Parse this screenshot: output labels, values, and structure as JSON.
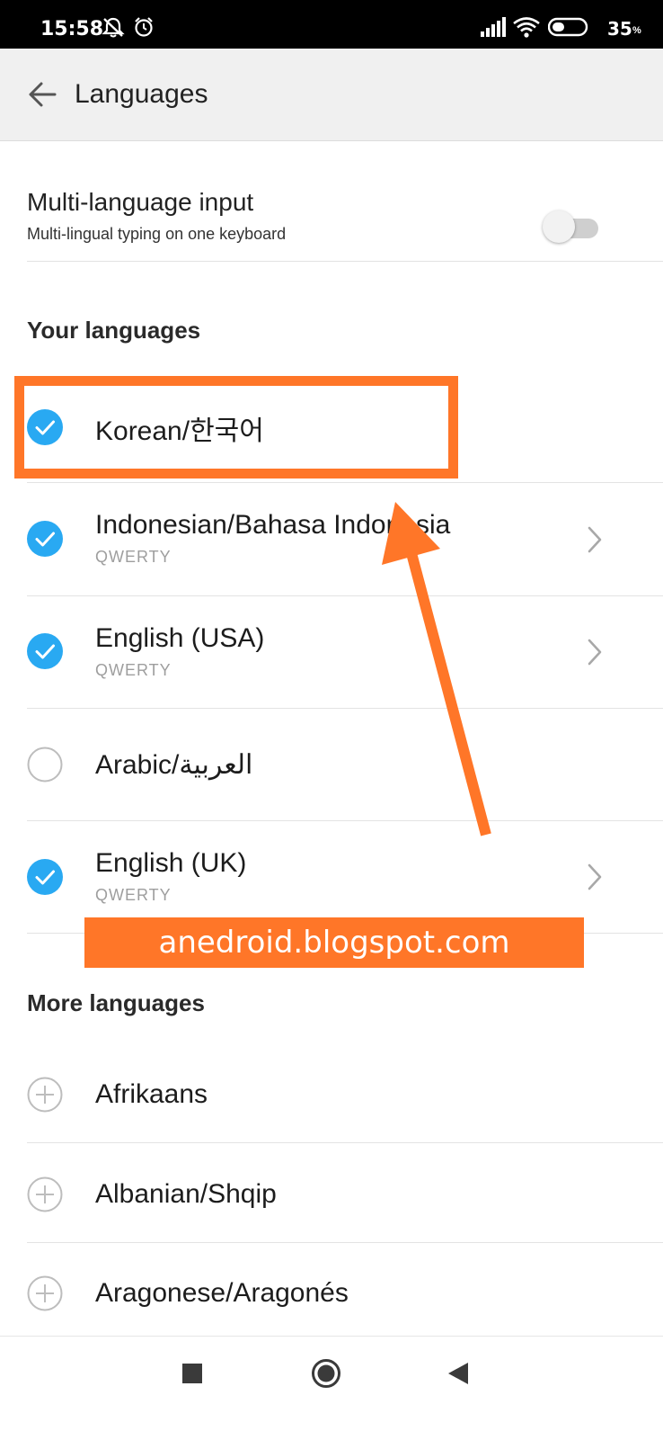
{
  "status_bar": {
    "time": "15:58",
    "battery": "35",
    "battery_unit": "%",
    "icons": [
      "mute-icon",
      "alarm-icon",
      "signal-icon",
      "wifi-icon",
      "battery-icon"
    ]
  },
  "app_bar": {
    "title": "Languages",
    "back_icon": "back-arrow-icon"
  },
  "multi_language": {
    "title": "Multi-language input",
    "subtitle": "Multi-lingual typing on one keyboard",
    "enabled": false
  },
  "your_languages": {
    "header": "Your languages",
    "items": [
      {
        "name": "Korean/한국어",
        "layout": "",
        "checked": true,
        "has_chevron": false
      },
      {
        "name": "Indonesian/Bahasa Indonesia",
        "layout": "QWERTY",
        "checked": true,
        "has_chevron": true
      },
      {
        "name": "English (USA)",
        "layout": "QWERTY",
        "checked": true,
        "has_chevron": true
      },
      {
        "name": "Arabic/العربية",
        "layout": "",
        "checked": false,
        "has_chevron": false
      },
      {
        "name": "English (UK)",
        "layout": "QWERTY",
        "checked": true,
        "has_chevron": true
      }
    ]
  },
  "more_languages": {
    "header": "More languages",
    "items": [
      {
        "name": "Afrikaans"
      },
      {
        "name": "Albanian/Shqip"
      },
      {
        "name": "Aragonese/Aragonés"
      }
    ]
  },
  "annotation": {
    "watermark": "anedroid.blogspot.com"
  },
  "colors": {
    "accent": "#29a9f2",
    "annotation": "#ff7628"
  },
  "nav_bar": {
    "buttons": [
      "recents-square-icon",
      "home-circle-icon",
      "back-triangle-icon"
    ]
  }
}
